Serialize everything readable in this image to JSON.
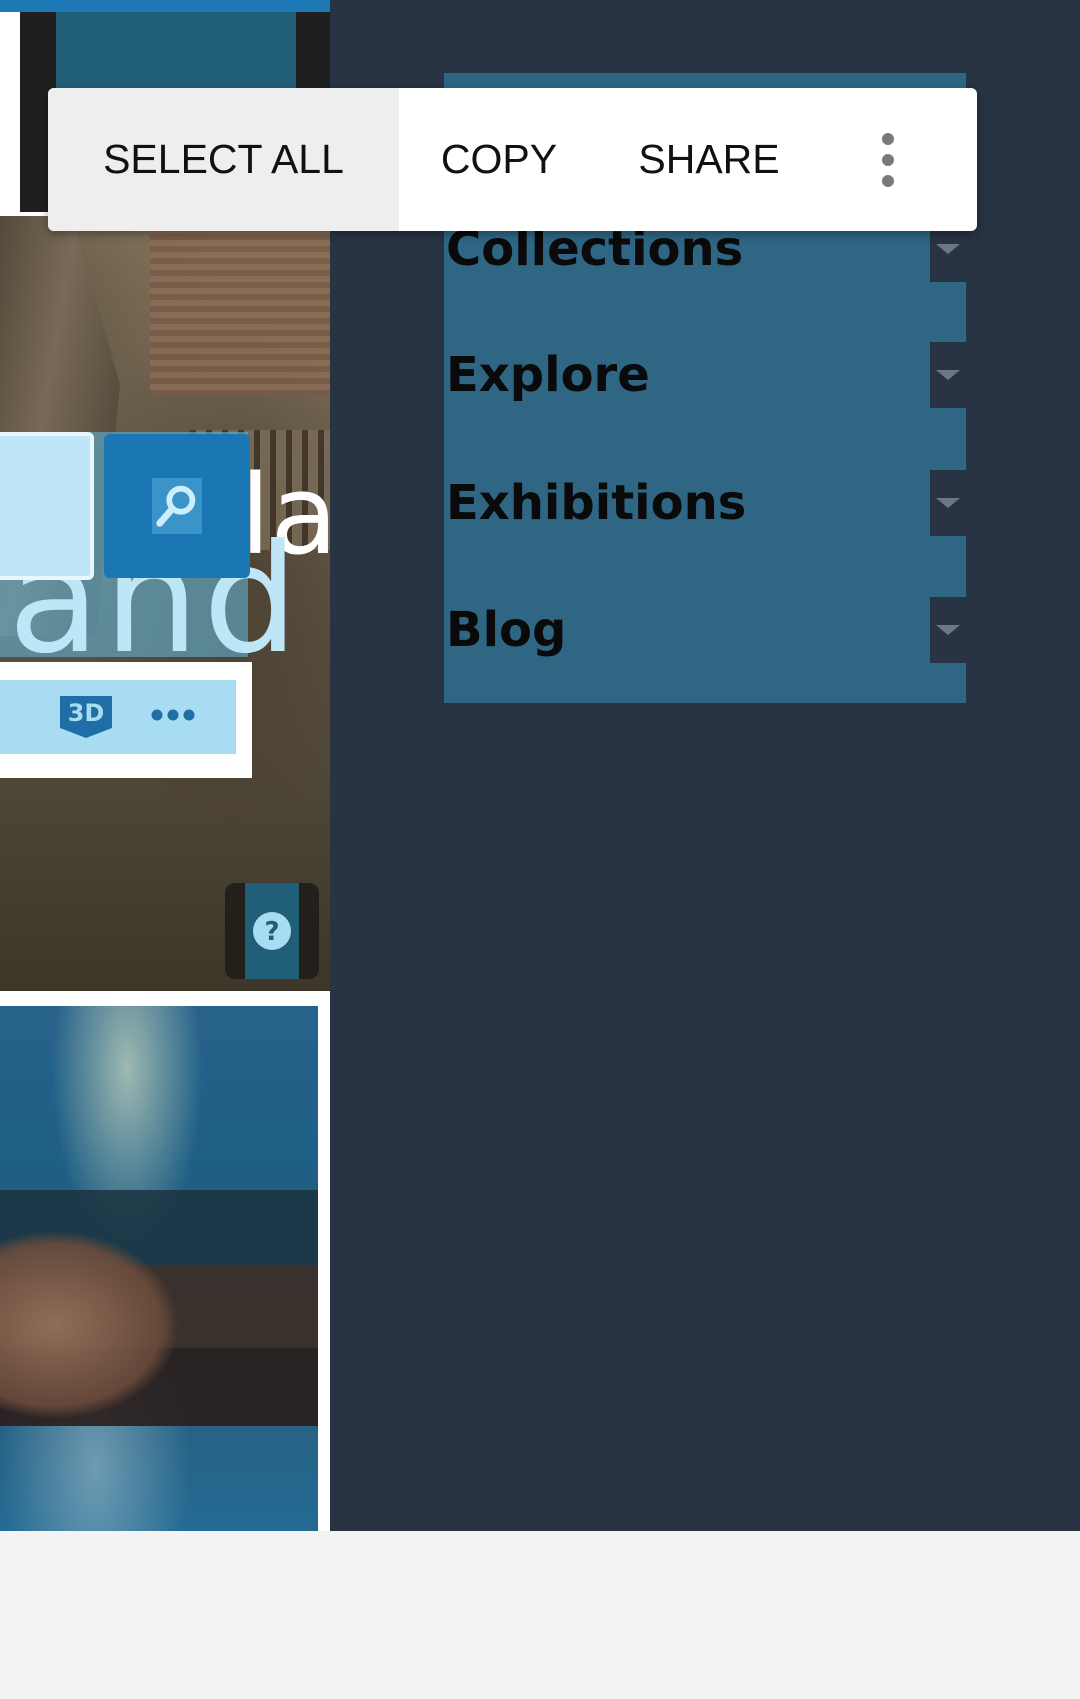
{
  "selection_toolbar": {
    "select_all": "SELECT ALL",
    "copy": "COPY",
    "share": "SHARE",
    "more_icon": "more-vert-icon"
  },
  "drawer_menu": {
    "items": [
      {
        "label": "Collections",
        "icon": "caret-down-icon"
      },
      {
        "label": "Explore",
        "icon": "caret-down-icon"
      },
      {
        "label": "Exhibitions",
        "icon": "caret-down-icon"
      },
      {
        "label": "Blog",
        "icon": "caret-down-icon"
      }
    ]
  },
  "background_page": {
    "hero_text_fragment": "and",
    "hero_text_right": "la",
    "icons": [
      "search-icon",
      "3d-icon",
      "more-horiz-icon",
      "help-icon"
    ]
  },
  "colors": {
    "drawer_bg": "#283443",
    "menu_bg": "#2e6684",
    "accent_blue": "#1b76b4",
    "light_blue": "#a7dcf2"
  }
}
